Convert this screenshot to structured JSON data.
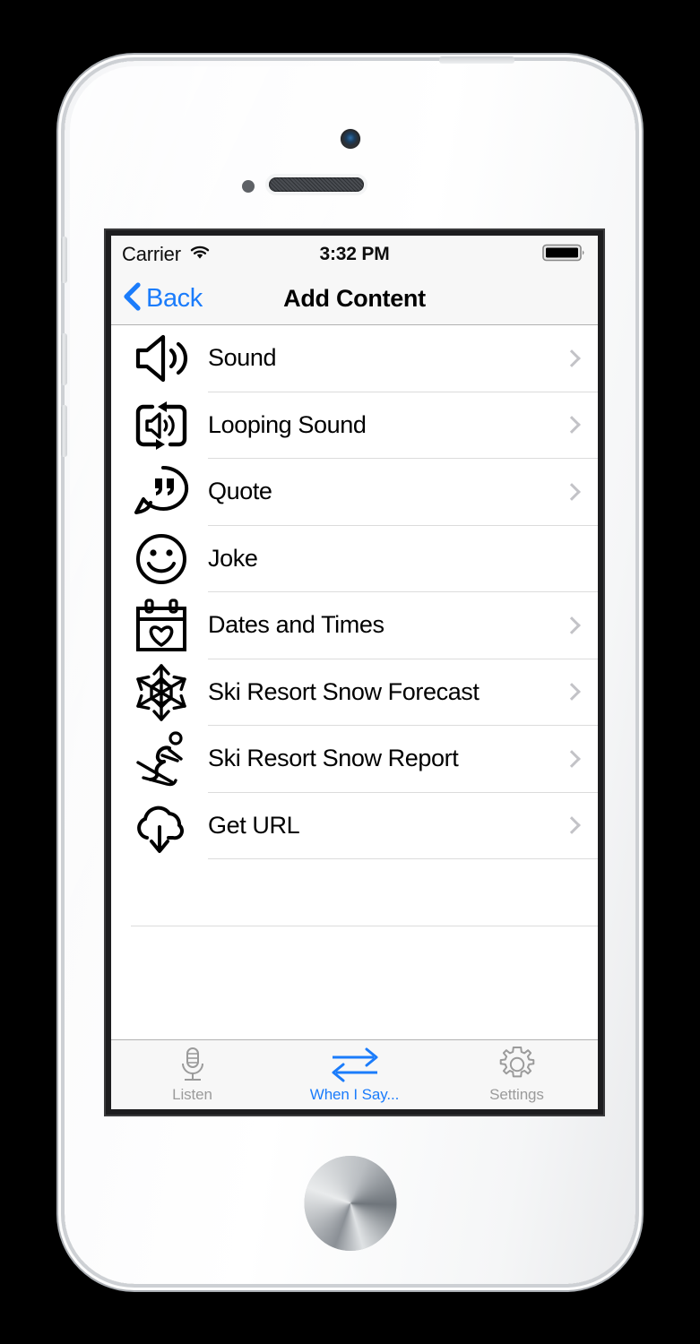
{
  "device": {
    "name": "iPhone 5s white",
    "camera_icon": "front-camera",
    "earpiece_icon": "earpiece-speaker",
    "home_button_icon": "home-button"
  },
  "status_bar": {
    "carrier": "Carrier",
    "wifi_icon": "wifi-icon",
    "time": "3:32 PM",
    "battery_icon": "battery-full-icon"
  },
  "nav_bar": {
    "back_label": "Back",
    "back_icon": "chevron-left-icon",
    "title": "Add Content"
  },
  "colors": {
    "accent_blue": "#1b7cfb",
    "inactive_gray": "#9b9b9b",
    "separator": "#dcdcdc",
    "bar_background": "#f7f7f7",
    "chevron": "#c3c3c7"
  },
  "list": {
    "rows": [
      {
        "label": "Sound",
        "icon": "speaker-icon",
        "has_chevron": true
      },
      {
        "label": "Looping Sound",
        "icon": "looping-speaker-icon",
        "has_chevron": true
      },
      {
        "label": "Quote",
        "icon": "quote-bubble-icon",
        "has_chevron": true
      },
      {
        "label": "Joke",
        "icon": "smiley-face-icon",
        "has_chevron": false
      },
      {
        "label": "Dates and Times",
        "icon": "calendar-heart-icon",
        "has_chevron": true
      },
      {
        "label": "Ski Resort Snow Forecast",
        "icon": "snowflake-icon",
        "has_chevron": true
      },
      {
        "label": "Ski Resort Snow Report",
        "icon": "skier-icon",
        "has_chevron": true
      },
      {
        "label": "Get URL",
        "icon": "cloud-download-icon",
        "has_chevron": true
      }
    ],
    "empty_rows": 2
  },
  "tab_bar": {
    "tabs": [
      {
        "label": "Listen",
        "icon": "microphone-icon",
        "active": false
      },
      {
        "label": "When I Say...",
        "icon": "swap-arrows-icon",
        "active": true
      },
      {
        "label": "Settings",
        "icon": "gear-icon",
        "active": false
      }
    ]
  }
}
